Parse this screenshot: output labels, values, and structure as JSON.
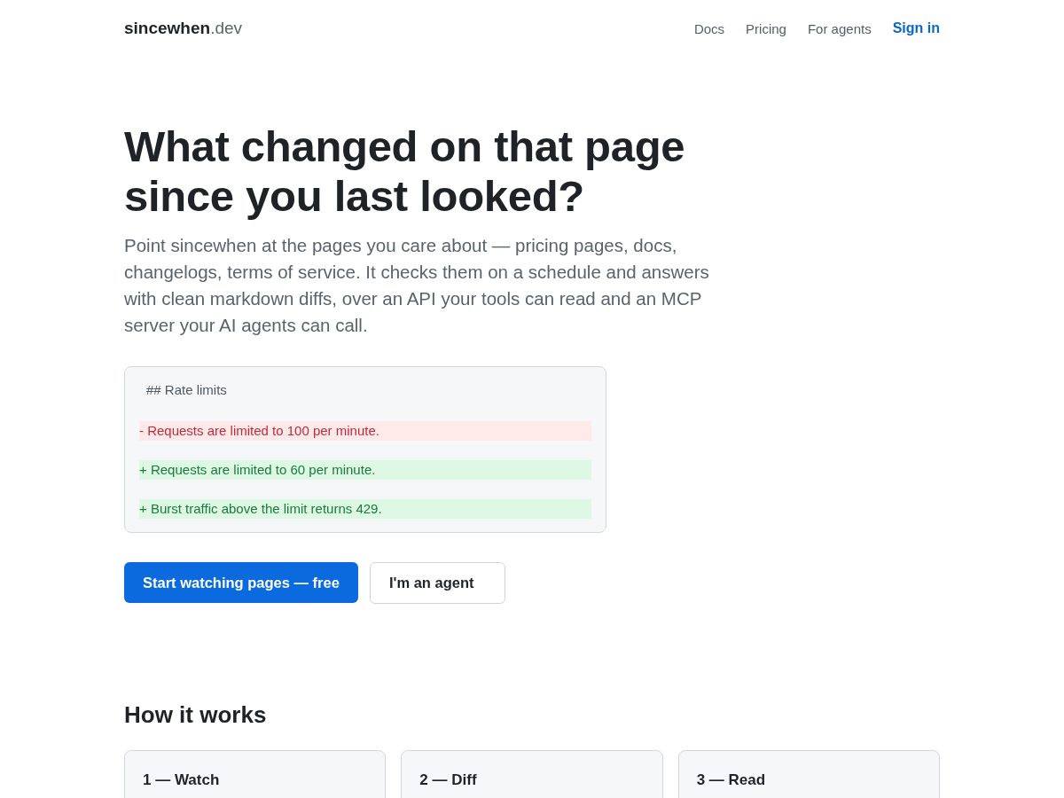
{
  "header": {
    "logo": "**sincewhen**.dev",
    "nav": [
      {
        "label": "Docs",
        "kind": "link"
      },
      {
        "label": "Pricing",
        "kind": "link"
      },
      {
        "label": "For agents",
        "kind": "link"
      },
      {
        "label": "Sign in",
        "kind": "sign_in"
      }
    ]
  },
  "hero": {
    "title": "What changed on that page since you last looked?",
    "description": "Point sincewhen at the pages you care about — pricing pages, docs, changelogs, terms of service. It checks them on a schedule and answers with clean markdown diffs, over an API your tools can read and an MCP server your AI agents can call.",
    "diff": {
      "heading": "## Rate limits",
      "lines": [
        {
          "kind": "removed",
          "text": "- Requests are limited to 100 per minute."
        },
        {
          "kind": "added",
          "text": "+ Requests are limited to 60 per minute."
        },
        {
          "kind": "added",
          "text": "+ Burst traffic above the limit returns 429."
        }
      ]
    },
    "actions": [
      {
        "label": "Start watching pages — free",
        "kind": "primary"
      },
      {
        "label": "I'm an agent",
        "kind": "secondary"
      }
    ]
  },
  "how_it_works": {
    "title": "How it works",
    "steps": [
      {
        "title": "1 — Watch"
      },
      {
        "title": "2 — Diff"
      },
      {
        "title": "3 — Read"
      }
    ]
  }
}
